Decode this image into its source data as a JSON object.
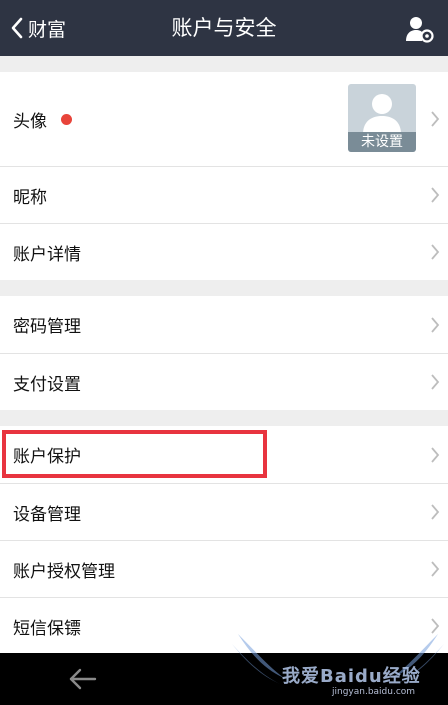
{
  "header": {
    "back_label": "财富",
    "title": "账户与安全"
  },
  "avatar": {
    "caption": "未设置"
  },
  "sections": [
    {
      "items": [
        {
          "label": "头像"
        },
        {
          "label": "昵称"
        },
        {
          "label": "账户详情"
        }
      ]
    },
    {
      "items": [
        {
          "label": "密码管理"
        },
        {
          "label": "支付设置"
        }
      ]
    },
    {
      "items": [
        {
          "label": "账户保护"
        },
        {
          "label": "设备管理"
        },
        {
          "label": "账户授权管理"
        },
        {
          "label": "短信保镖"
        }
      ]
    }
  ],
  "watermark": {
    "brand": "我爱Baidu经验",
    "url": "jingyan.baidu.com"
  },
  "colors": {
    "header_bg": "#2e3443",
    "highlight": "#e8343f",
    "badge_dot": "#e8443a"
  },
  "icons": {
    "back": "chevron-left-icon",
    "user_settings": "user-settings-icon",
    "row_arrow": "chevron-right-icon",
    "nav_back": "arrow-left-icon"
  }
}
